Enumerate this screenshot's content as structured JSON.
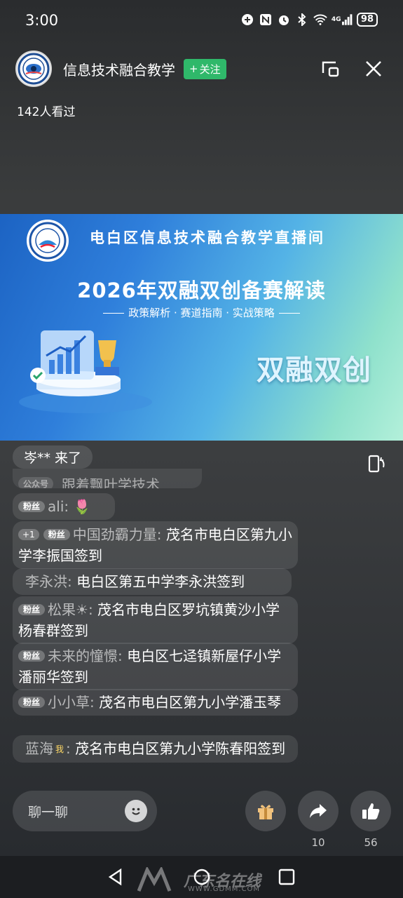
{
  "status_bar": {
    "time": "3:00",
    "battery": "98",
    "network": "4G"
  },
  "header": {
    "channel_name": "信息技术融合教学",
    "follow_label": "关注",
    "follow_plus": "+",
    "viewers": "142人看过"
  },
  "banner": {
    "title": "电白区信息技术融合教学直播间",
    "main_title": "2026年双融双创备赛解读",
    "subtitle": "政策解析 · 赛道指南 · 实战策略",
    "big_text": "双融双创",
    "accent_color": "#2f7fdb"
  },
  "chat": {
    "join_notice": "岑** 来了",
    "faded_badge": "公众号",
    "faded_text": "跟着飘叶学技术",
    "messages": [
      {
        "badge": "粉丝",
        "nick": "ali:",
        "text": "🌷"
      },
      {
        "plus": "+1",
        "badge": "粉丝",
        "nick": "中国劲霸力量:",
        "text": "茂名市电白区第九小学李振国签到"
      },
      {
        "nick": "李永洪:",
        "text": "电白区第五中学李永洪签到"
      },
      {
        "badge": "粉丝",
        "nick": "松果☀:",
        "text": "茂名市电白区罗坑镇黄沙小学杨春群签到"
      },
      {
        "badge": "粉丝",
        "nick": "未来的憧憬:",
        "text": "电白区七迳镇新屋仔小学潘丽华签到"
      },
      {
        "badge": "粉丝",
        "nick": "小小草:",
        "text": "茂名市电白区第九小学潘玉琴"
      },
      {
        "nick": "蓝海",
        "me_tag": "我",
        "nick_suffix": ":",
        "text": "茂名市电白区第九小学陈春阳签到"
      }
    ]
  },
  "bottom_bar": {
    "input_placeholder": "聊一聊",
    "share_count": "10",
    "like_count": "56"
  },
  "watermark": {
    "text": "广东名在线",
    "url": "WWW.GDMM.COM"
  }
}
